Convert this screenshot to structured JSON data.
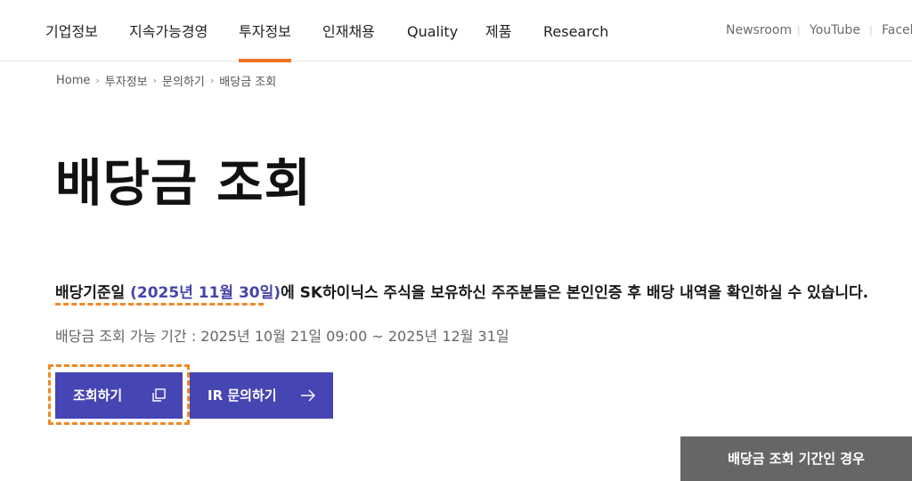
{
  "nav": {
    "items": [
      {
        "label": "기업정보"
      },
      {
        "label": "지속가능경영"
      },
      {
        "label": "투자정보",
        "active": true
      },
      {
        "label": "인재채용"
      },
      {
        "label": "Quality"
      },
      {
        "label": "제품"
      },
      {
        "label": "Research"
      }
    ],
    "utility": [
      {
        "label": "Newsroom"
      },
      {
        "label": "YouTube"
      },
      {
        "label": "Faceb"
      }
    ],
    "separator": "|",
    "accent_color": "#f47321"
  },
  "breadcrumb": [
    "Home",
    "투자정보",
    "문의하기",
    "배당금 조회"
  ],
  "page": {
    "title": "배당금 조회",
    "notice_prefix": "배당기준일 ",
    "notice_date": "(2025년 11월 30일)",
    "notice_suffix": "에 SK하이닉스 주식을 보유하신 주주분들은 본인인증 후 배당 내역을 확인하실 수 있습니다.",
    "period": "배당금 조회 가능 기간 : 2025년 10월 21일 09:00 ~ 2025년 12월 31일"
  },
  "buttons": {
    "lookup": {
      "label": "조회하기",
      "icon": "external-window-icon"
    },
    "ir_inquiry": {
      "label": "IR 문의하기",
      "icon": "arrow-right-icon"
    },
    "after_period": {
      "label": "배당금 조회 기간인 경우"
    }
  },
  "colors": {
    "primary_button": "#4645b4",
    "date_highlight": "#4645aa",
    "annotation": "#f08a24",
    "side_button": "#666666"
  }
}
